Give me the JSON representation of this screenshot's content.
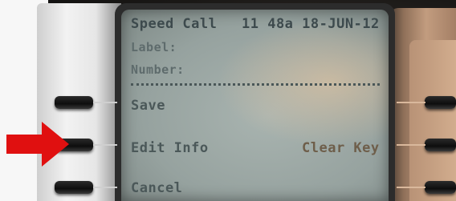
{
  "screen": {
    "title": "Speed Call",
    "datetime": "11 48a 18-JUN-12",
    "field_label": "Label:",
    "field_number": "Number:"
  },
  "softkeys": {
    "save": "Save",
    "edit_info": "Edit Info",
    "clear_key": "Clear Key",
    "cancel": "Cancel"
  },
  "annotation": {
    "arrow_color": "#e01010",
    "points_to": "edit-info-softkey"
  },
  "colors": {
    "lcd_background": "#9aa5a2",
    "lcd_text": "#3d4a4d",
    "bezel": "#a47f65"
  }
}
